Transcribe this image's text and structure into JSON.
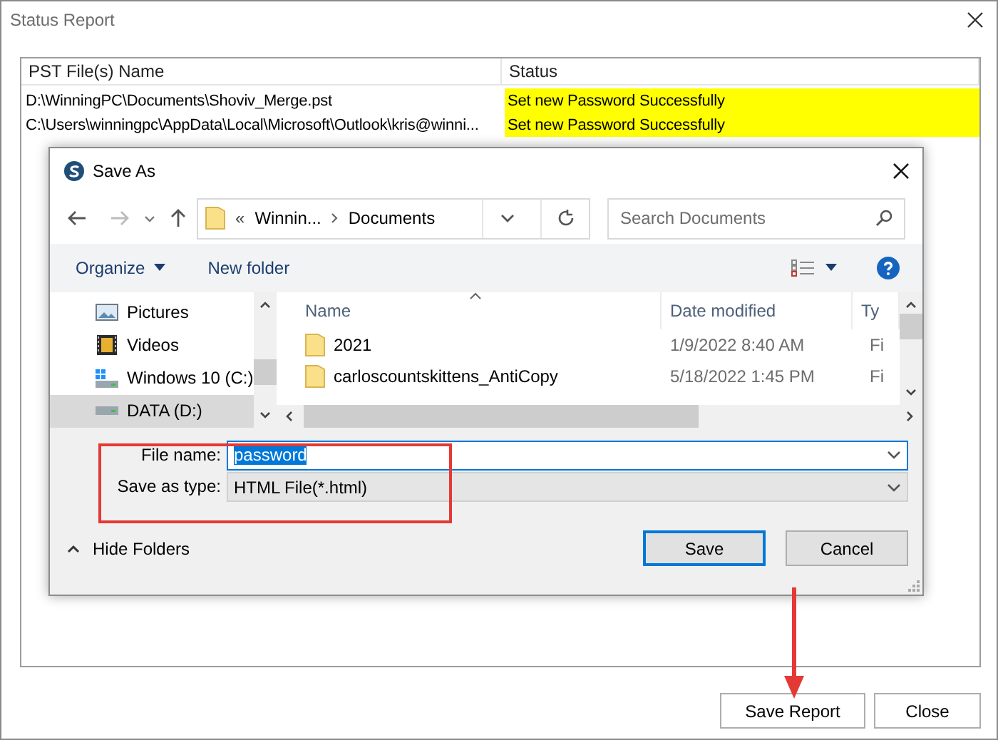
{
  "window": {
    "title": "Status Report"
  },
  "table": {
    "columns": [
      "PST File(s) Name",
      "Status"
    ],
    "rows": [
      {
        "file": "D:\\WinningPC\\Documents\\Shoviv_Merge.pst",
        "status": "Set new Password Successfully"
      },
      {
        "file": "C:\\Users\\winningpc\\AppData\\Local\\Microsoft\\Outlook\\kris@winni...",
        "status": "Set new Password Successfully"
      }
    ]
  },
  "buttons": [
    "Save Report",
    "Close"
  ],
  "dialog": {
    "title": "Save As",
    "path_prefix": "«",
    "path": [
      "Winnin...",
      "Documents"
    ],
    "search": {
      "placeholder": "Search Documents"
    },
    "toolbar": [
      "Organize",
      "New folder"
    ],
    "nav_items": [
      {
        "kind": "pictures",
        "label": "Pictures",
        "selected": false
      },
      {
        "kind": "videos",
        "label": "Videos",
        "selected": false
      },
      {
        "kind": "system-drive",
        "label": "Windows 10 (C:)",
        "selected": false
      },
      {
        "kind": "drive",
        "label": "DATA (D:)",
        "selected": true
      }
    ],
    "columns": [
      "Name",
      "Date modified",
      "Ty"
    ],
    "files": [
      {
        "name": "2021",
        "date": "1/9/2022 8:40 AM",
        "type": "Fi"
      },
      {
        "name": "carloscountskittens_AntiCopy",
        "date": "5/18/2022 1:45 PM",
        "type": "Fi"
      }
    ],
    "file_name": {
      "label": "File name:",
      "value": "password"
    },
    "save_type": {
      "label": "Save as type:",
      "value": "HTML File(*.html)"
    },
    "hide_folders": "Hide Folders",
    "buttons": [
      {
        "label": "Save",
        "default": true
      },
      {
        "label": "Cancel",
        "default": false
      }
    ]
  }
}
